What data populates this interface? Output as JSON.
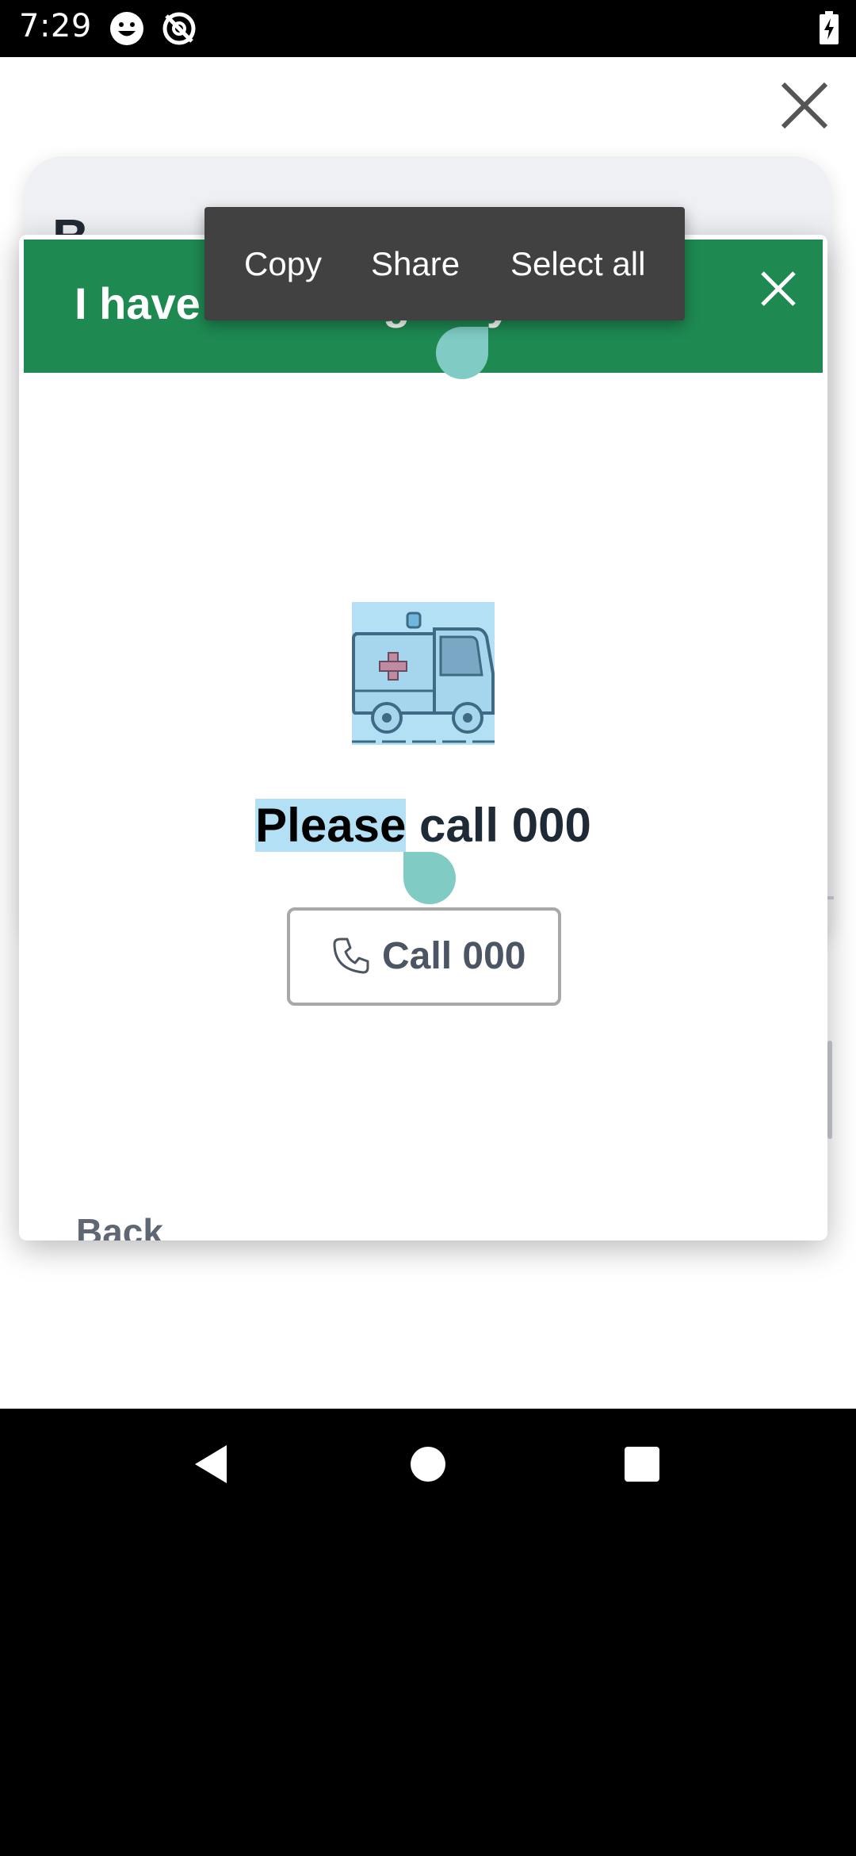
{
  "status_bar": {
    "time": "7:29",
    "icons": [
      "smiley-icon",
      "no-sync-icon",
      "battery-charging-icon"
    ]
  },
  "background": {
    "heading_fragment": "B"
  },
  "context_menu": {
    "copy": "Copy",
    "share": "Share",
    "select_all": "Select all"
  },
  "modal": {
    "title": "I have an emergency",
    "image": "ambulance-icon",
    "message_selected": "Please",
    "message_rest": " call 000",
    "call_button_label": "Call 000",
    "back_label": "Back"
  },
  "colors": {
    "header_green": "#1e8a52",
    "selection_highlight": "#b3e0f5",
    "selection_handle": "#80cbc4",
    "menu_bg": "#414141"
  },
  "nav_bar": {
    "buttons": [
      "back-triangle-icon",
      "home-circle-icon",
      "recents-square-icon"
    ]
  }
}
